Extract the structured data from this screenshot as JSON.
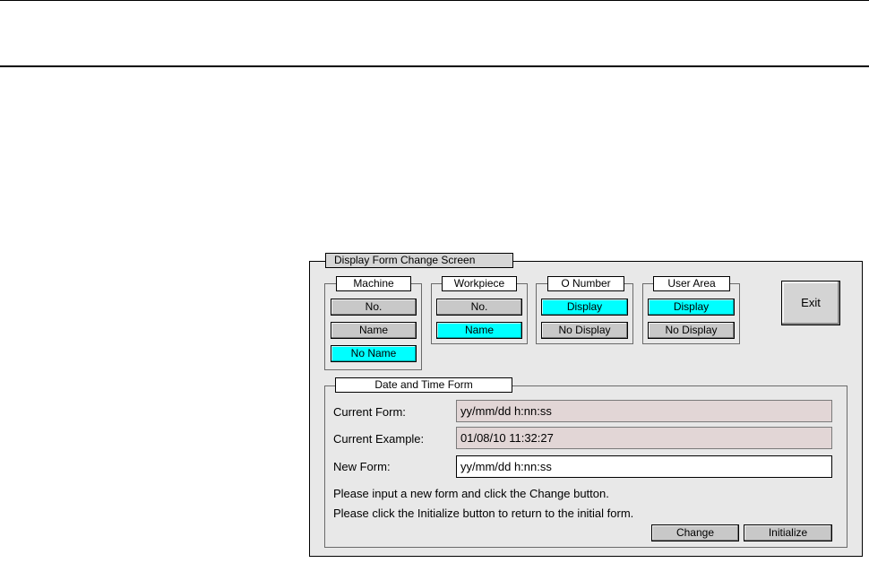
{
  "window": {
    "title": "Display Form Change Screen"
  },
  "groups": {
    "machine": {
      "title": "Machine",
      "options": [
        "No.",
        "Name",
        "No Name"
      ],
      "selected": "No Name"
    },
    "workpiece": {
      "title": "Workpiece",
      "options": [
        "No.",
        "Name"
      ],
      "selected": "Name"
    },
    "o_number": {
      "title": "O Number",
      "options": [
        "Display",
        "No Display"
      ],
      "selected": "Display"
    },
    "user_area": {
      "title": "User Area",
      "options": [
        "Display",
        "No Display"
      ],
      "selected": "Display"
    }
  },
  "exit_label": "Exit",
  "datetime": {
    "title": "Date and Time Form",
    "current_form_label": "Current Form:",
    "current_form_value": "yy/mm/dd h:nn:ss",
    "current_example_label": "Current Example:",
    "current_example_value": "01/08/10 11:32:27",
    "new_form_label": "New Form:",
    "new_form_value": "yy/mm/dd h:nn:ss",
    "message_1": "Please input a new form and click the Change button.",
    "message_2": "Please click the Initialize button to return to the initial form.",
    "change_label": "Change",
    "initialize_label": "Initialize"
  },
  "colors": {
    "selected": "#00ffff",
    "unselected": "#c8c8c8",
    "panel": "#e8e8e8",
    "readonly_field": "#e2d6d6"
  }
}
